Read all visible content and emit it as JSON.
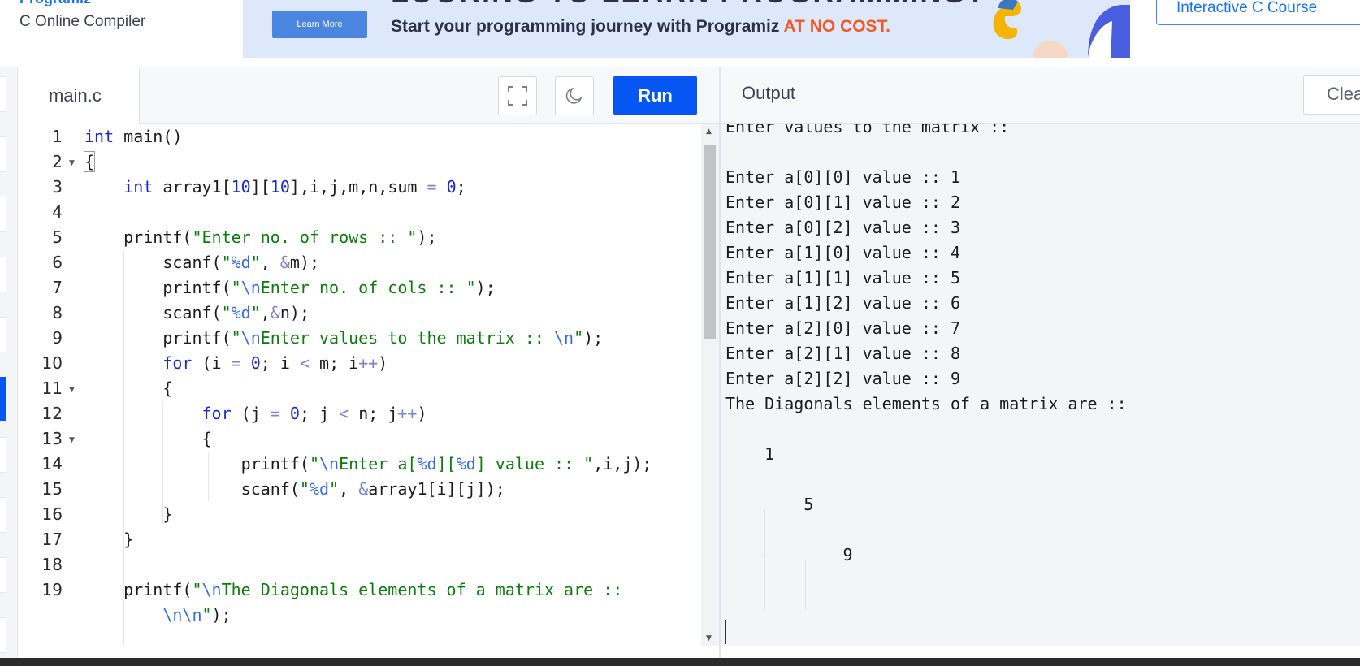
{
  "header": {
    "brand": "Programiz",
    "subtitle": "C Online Compiler",
    "ad": {
      "button": "Learn More",
      "headline": "LOOKING TO LEARN PROGRAMMING?",
      "text": "Start your programming journey with Programiz ",
      "accent": "AT NO COST."
    },
    "course_button": "Interactive C Course"
  },
  "editor": {
    "tab": "main.c",
    "run_label": "Run",
    "lines": [
      {
        "n": "1",
        "html": "<span class=\"kw\">int</span> main()"
      },
      {
        "n": "2",
        "html": "<span class=\"brace-hl\">{</span>",
        "fold": true
      },
      {
        "n": "3",
        "html": "    <span class=\"kw\">int</span> array1[<span class=\"num\">10</span>][<span class=\"num\">10</span>],i,j,m,n,sum <span class=\"op\">=</span> <span class=\"num\">0</span>;"
      },
      {
        "n": "4",
        "html": ""
      },
      {
        "n": "5",
        "html": "    printf(<span class=\"str\">\"Enter no. of rows :: \"</span>);"
      },
      {
        "n": "6",
        "html": "        scanf(<span class=\"str\">\"<span class=\"esc\">%d</span>\"</span>, <span class=\"op\">&amp;</span>m);"
      },
      {
        "n": "7",
        "html": "        printf(<span class=\"str\">\"<span class=\"esc\">\\n</span>Enter no. of cols :: \"</span>);"
      },
      {
        "n": "8",
        "html": "        scanf(<span class=\"str\">\"<span class=\"esc\">%d</span>\"</span>,<span class=\"op\">&amp;</span>n);"
      },
      {
        "n": "9",
        "html": "        printf(<span class=\"str\">\"<span class=\"esc\">\\n</span>Enter values to the matrix :: <span class=\"esc\">\\n</span>\"</span>);"
      },
      {
        "n": "10",
        "html": "        <span class=\"kw\">for</span> (i <span class=\"op\">=</span> <span class=\"num\">0</span>; i <span class=\"op\">&lt;</span> m; i<span class=\"op\">++</span>)"
      },
      {
        "n": "11",
        "html": "        {",
        "fold": true
      },
      {
        "n": "12",
        "html": "            <span class=\"kw\">for</span> (j <span class=\"op\">=</span> <span class=\"num\">0</span>; j <span class=\"op\">&lt;</span> n; j<span class=\"op\">++</span>)"
      },
      {
        "n": "13",
        "html": "            {",
        "fold": true
      },
      {
        "n": "14",
        "html": "                printf(<span class=\"str\">\"<span class=\"esc\">\\n</span>Enter a[<span class=\"esc\">%d</span>][<span class=\"esc\">%d</span>] value :: \"</span>,i,j);"
      },
      {
        "n": "15",
        "html": "                scanf(<span class=\"str\">\"<span class=\"esc\">%d</span>\"</span>, <span class=\"op\">&amp;</span>array1[i][j]);"
      },
      {
        "n": "16",
        "html": "        }"
      },
      {
        "n": "17",
        "html": "    }"
      },
      {
        "n": "18",
        "html": ""
      },
      {
        "n": "19",
        "html": "    printf(<span class=\"str\">\"<span class=\"esc\">\\n</span>The Diagonals elements of a matrix are ::</span>"
      },
      {
        "n": "",
        "html": "        <span class=\"str\"><span class=\"esc\">\\n\\n</span>\"</span>);"
      }
    ]
  },
  "output": {
    "title": "Output",
    "clear_label": "Clear",
    "lines": [
      "Enter values to the matrix ::",
      "",
      "Enter a[0][0] value :: 1",
      "Enter a[0][1] value :: 2",
      "Enter a[0][2] value :: 3",
      "Enter a[1][0] value :: 4",
      "Enter a[1][1] value :: 5",
      "Enter a[1][2] value :: 6",
      "Enter a[2][0] value :: 7",
      "Enter a[2][1] value :: 8",
      "Enter a[2][2] value :: 9",
      "The Diagonals elements of a matrix are ::",
      "",
      "    1",
      "",
      "        5",
      "",
      "            9"
    ]
  }
}
